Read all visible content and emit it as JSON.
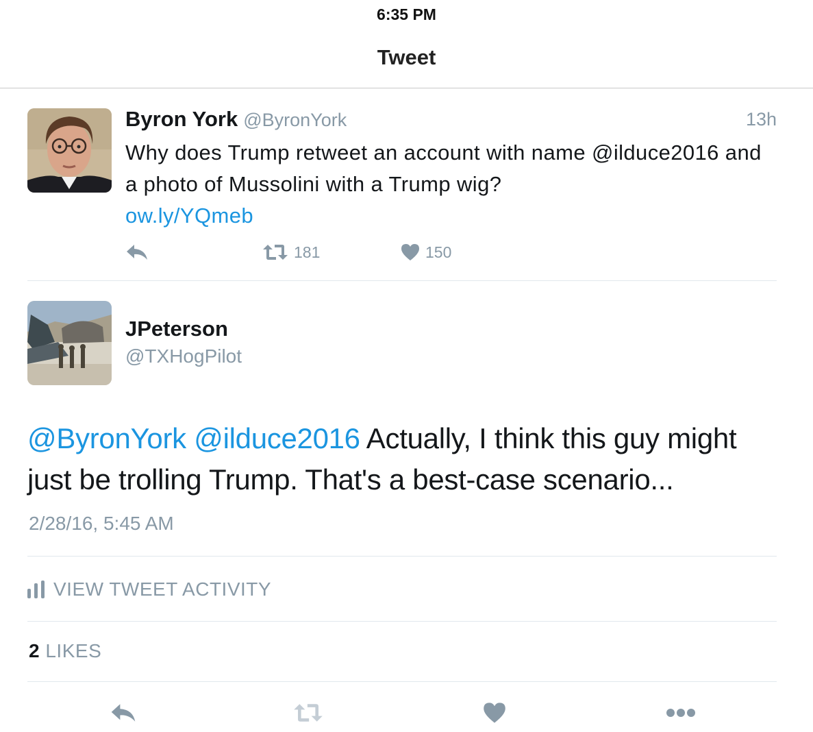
{
  "status_bar": {
    "time": "6:35 PM"
  },
  "nav": {
    "title": "Tweet"
  },
  "parent_tweet": {
    "name": "Byron York",
    "handle": "@ByronYork",
    "time": "13h",
    "text": "Why does Trump retweet an account with name @ilduce2016 and a photo of Mussolini with a Trump wig?",
    "link": "ow.ly/YQmeb",
    "retweets": "181",
    "likes": "150",
    "icons": {
      "reply": "reply-icon",
      "retweet": "retweet-icon",
      "like": "heart-icon"
    }
  },
  "main_tweet": {
    "name": "JPeterson",
    "handle": "@TXHogPilot",
    "mention1": "@ByronYork",
    "mention2": "@ilduce2016",
    "text": " Actually, I think this guy might just be trolling Trump. That's a best-case scenario...",
    "date": "2/28/16, 5:45 AM"
  },
  "activity": {
    "label": "VIEW TWEET ACTIVITY",
    "icon": "bar-chart-icon"
  },
  "likes_row": {
    "count": "2",
    "label": "LIKES"
  },
  "toolbar": {
    "icons": [
      "reply-icon",
      "retweet-icon",
      "heart-icon",
      "more-icon"
    ]
  },
  "colors": {
    "link": "#1b95e0",
    "muted": "#8899a6",
    "text": "#14171a",
    "divider": "#e1e8ed"
  }
}
